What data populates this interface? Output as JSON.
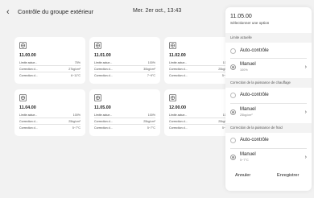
{
  "header": {
    "title": "Contrôle du groupe extérieur",
    "datetime": "Mer. 2er oct., 13:43"
  },
  "cards": [
    {
      "id": "11.00.00",
      "rows": [
        {
          "label": "Limite actue...",
          "value": "75%"
        },
        {
          "label": "Correction d...",
          "value": "27kg/cm²"
        },
        {
          "label": "Correction d...",
          "value": "6~11°C"
        }
      ]
    },
    {
      "id": "11.01.00",
      "rows": [
        {
          "label": "Limite actue...",
          "value": "100%"
        },
        {
          "label": "Correction d...",
          "value": "30kg/cm²"
        },
        {
          "label": "Correction d...",
          "value": "7~9°C"
        }
      ]
    },
    {
      "id": "11.02.00",
      "rows": [
        {
          "label": "Limite actue...",
          "value": "100%"
        },
        {
          "label": "Correction d...",
          "value": "25kg/cm²"
        },
        {
          "label": "Correction d...",
          "value": "5~7°C"
        }
      ]
    },
    {
      "id": "11.04.00",
      "rows": [
        {
          "label": "Limite actue...",
          "value": "100%"
        },
        {
          "label": "Correction d...",
          "value": "25kg/cm²"
        },
        {
          "label": "Correction d...",
          "value": "5~7°C"
        }
      ]
    },
    {
      "id": "11.05.00",
      "rows": [
        {
          "label": "Limite actue...",
          "value": "100%"
        },
        {
          "label": "Correction d...",
          "value": "25kg/cm²"
        },
        {
          "label": "Correction d...",
          "value": "5~7°C"
        }
      ]
    },
    {
      "id": "12.00.00",
      "rows": [
        {
          "label": "Limite actue...",
          "value": "100%"
        },
        {
          "label": "Correction d...",
          "value": "25kg/cm²"
        },
        {
          "label": "Correction d...",
          "value": "5~7°C"
        }
      ]
    }
  ],
  "panel": {
    "title": "11.05.00",
    "subtitle": "Sélectionner une option",
    "sections": [
      {
        "label": "Limite actuelle",
        "auto_label": "Auto-contrôle",
        "manual_label": "Manuel",
        "manual_value": "100%"
      },
      {
        "label": "Correction de la puissance de chauffage",
        "auto_label": "Auto-contrôle",
        "manual_label": "Manuel",
        "manual_value": "25kg/cm²"
      },
      {
        "label": "Correction de la puissance de froid",
        "auto_label": "Auto-contrôle",
        "manual_label": "Manuel",
        "manual_value": "5~7°C"
      }
    ],
    "cancel_label": "Annuler",
    "save_label": "Enregistrer"
  }
}
